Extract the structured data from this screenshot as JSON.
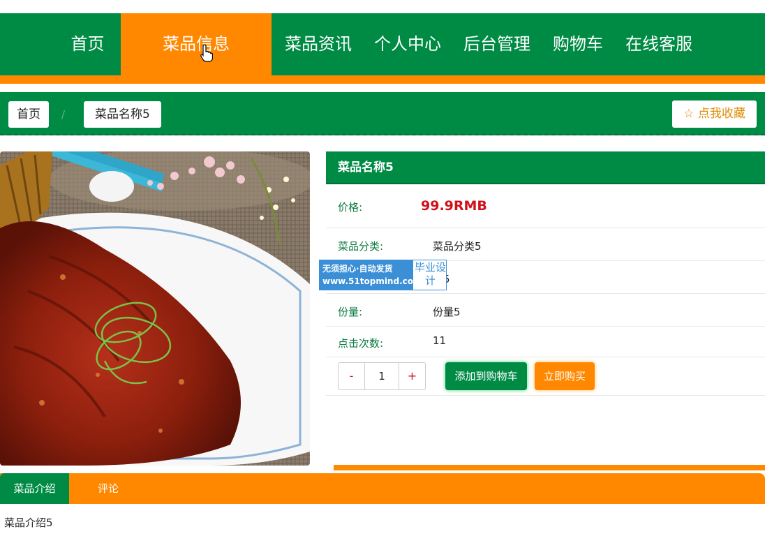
{
  "nav": {
    "items": [
      {
        "label": "首页"
      },
      {
        "label": "菜品信息"
      },
      {
        "label": "菜品资讯"
      },
      {
        "label": "个人中心"
      },
      {
        "label": "后台管理"
      },
      {
        "label": "购物车"
      },
      {
        "label": "在线客服"
      }
    ],
    "active_index": 1
  },
  "breadcrumb": {
    "home": "首页",
    "separator": "/",
    "current": "菜品名称5"
  },
  "favorite_button": {
    "icon": "star-outline-icon",
    "label": "☆ 点我收藏"
  },
  "product": {
    "name": "菜品名称5",
    "price_label": "价格:",
    "price": "99.9RMB",
    "fields": [
      {
        "label": "菜品分类:",
        "value": "菜品分类5"
      },
      {
        "label": "",
        "value": "料5"
      },
      {
        "label": "份量:",
        "value": "份量5"
      },
      {
        "label": "点击次数:",
        "value": "11"
      }
    ]
  },
  "watermark": {
    "line1": "无须担心·自动发货",
    "line2": "www.51topmind.com",
    "right": "毕业设计"
  },
  "quantity": {
    "minus": "-",
    "value": "1",
    "plus": "+"
  },
  "actions": {
    "add_to_cart": "添加到购物车",
    "buy_now": "立即购买"
  },
  "tabs": [
    {
      "label": "菜品介绍"
    },
    {
      "label": "评论"
    }
  ],
  "tab_content": "菜品介绍5",
  "colors": {
    "primary_green": "#008b45",
    "accent_orange": "#ff8800",
    "price_red": "#d0111b"
  }
}
